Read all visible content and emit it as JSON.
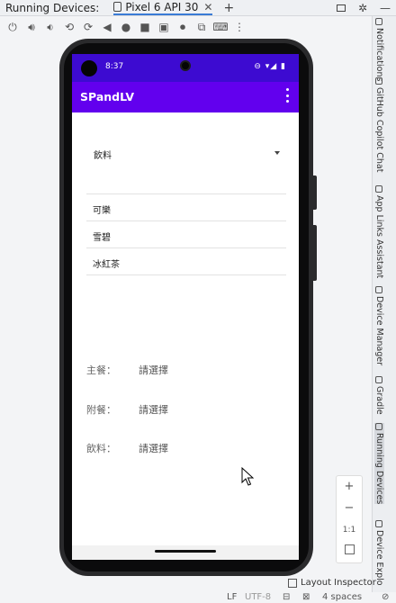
{
  "tab_bar": {
    "label": "Running Devices:",
    "device_tab": "Pixel 6 API 30",
    "add": "+"
  },
  "right_tools": [
    {
      "label": "Notifications"
    },
    {
      "label": "GitHub Copilot Chat"
    },
    {
      "label": "App Links Assistant"
    },
    {
      "label": "Device Manager"
    },
    {
      "label": "Gradle"
    },
    {
      "label": "Running Devices",
      "active": true
    },
    {
      "label": "Device Explo"
    }
  ],
  "phone": {
    "status_time": "8:37",
    "app_title": "SPandLV",
    "spinner_value": "飲料",
    "list_items": [
      "可樂",
      "雪碧",
      "冰紅茶"
    ],
    "rows": [
      {
        "key": "主餐：",
        "value": "請選擇"
      },
      {
        "key": "附餐：",
        "value": "請選擇"
      },
      {
        "key": "飲料：",
        "value": "請選擇"
      }
    ]
  },
  "zoom_controls": {
    "plus": "+",
    "minus": "−",
    "ratio": "1:1"
  },
  "layout_inspector": "Layout Inspector",
  "statusline": {
    "lf": "LF",
    "encoding": "UTF-8",
    "indent": "4 spaces"
  },
  "colors": {
    "status_bar": "#3d0bd1",
    "app_bar": "#6200ee"
  }
}
